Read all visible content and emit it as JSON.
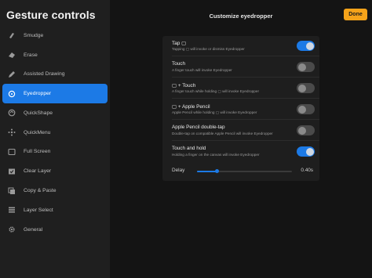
{
  "sidebar": {
    "title": "Gesture controls",
    "items": [
      {
        "label": "Smudge",
        "icon": "smudge-icon"
      },
      {
        "label": "Erase",
        "icon": "eraser-icon"
      },
      {
        "label": "Assisted Drawing",
        "icon": "pencil-icon"
      },
      {
        "label": "Eyedropper",
        "icon": "eyedropper-icon",
        "active": true
      },
      {
        "label": "QuickShape",
        "icon": "quickshape-icon"
      },
      {
        "label": "QuickMenu",
        "icon": "quickmenu-icon"
      },
      {
        "label": "Full Screen",
        "icon": "fullscreen-icon"
      },
      {
        "label": "Clear Layer",
        "icon": "clear-layer-icon"
      },
      {
        "label": "Copy & Paste",
        "icon": "copy-icon"
      },
      {
        "label": "Layer Select",
        "icon": "layers-icon"
      },
      {
        "label": "General",
        "icon": "gear-icon"
      }
    ]
  },
  "header": {
    "title": "Customize eyedropper",
    "done_label": "Done"
  },
  "settings": [
    {
      "title": "Tap ▢",
      "desc": "Tapping ▢ will invoke or dismiss Eyedropper",
      "on": true
    },
    {
      "title": "Touch",
      "desc": "A finger touch will invoke Eyedropper",
      "on": false
    },
    {
      "title": "▢ + Touch",
      "desc": "A finger touch while holding ▢ will invoke Eyedropper",
      "on": false
    },
    {
      "title": "▢ + Apple Pencil",
      "desc": "Apple Pencil while holding ▢ will invoke Eyedropper",
      "on": false
    },
    {
      "title": "Apple Pencil double-tap",
      "desc": "Double-tap on compatible Apple Pencil will invoke Eyedropper",
      "on": false
    },
    {
      "title": "Touch and hold",
      "desc": "Holding a finger on the canvas will invoke Eyedropper",
      "on": true
    }
  ],
  "delay": {
    "label": "Delay",
    "value_text": "0.40s",
    "fraction": 0.21
  },
  "colors": {
    "accent": "#1c7ae6",
    "done": "#f5a31a"
  }
}
